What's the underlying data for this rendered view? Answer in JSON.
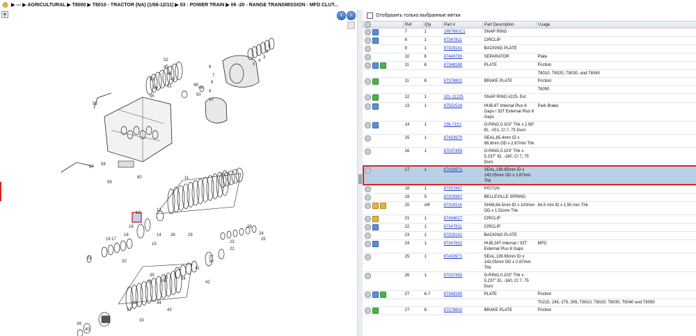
{
  "breadcrumb": [
    "---",
    "AGRICULTURAL",
    "T8000",
    "T8010 - TRACTOR (NA) (1/06-12/11)",
    "03 - POWER TRAIN",
    "06 -20 - RANGE TRANSMISSION - MFD CLUT..."
  ],
  "filter_label": "Отобразить только выбранные метки",
  "columns": {
    "ref": "Ref",
    "qty": "Qty",
    "part": "Part #",
    "desc": "Part Description",
    "usage": "Usage"
  },
  "rows": [
    {
      "icons": [
        "circle",
        "blue"
      ],
      "ref": "7",
      "qty": "1",
      "part": "1997891C1",
      "desc": "SNAP RING",
      "usage": ""
    },
    {
      "icons": [
        "circle",
        "blue"
      ],
      "ref": "8",
      "qty": "1",
      "part": "87347811",
      "desc": "CIRCLIP",
      "usage": ""
    },
    {
      "icons": [
        "circle"
      ],
      "ref": "9",
      "qty": "1",
      "part": "87329141",
      "desc": "BACKING PLATE",
      "usage": ""
    },
    {
      "icons": [
        "circle"
      ],
      "ref": "10",
      "qty": "6",
      "part": "87449793",
      "desc": "SEPARATOR",
      "usage": "Plate"
    },
    {
      "icons": [
        "circle",
        "blue",
        "green"
      ],
      "ref": "11",
      "qty": "6",
      "part": "87348160",
      "desc": "PLATE",
      "usage": "Friction"
    },
    {
      "icons": [],
      "ref": "",
      "qty": "",
      "part": "",
      "desc": "",
      "usage": "T8010, T8020, T8030, and T8040"
    },
    {
      "icons": [
        "circle",
        "green"
      ],
      "ref": "11",
      "qty": "6",
      "part": "87378802",
      "desc": "BRAKE PLATE",
      "usage": "Friction"
    },
    {
      "icons": [],
      "ref": "",
      "qty": "",
      "part": "",
      "desc": "",
      "usage": "T8050"
    },
    {
      "icons": [
        "circle",
        "green"
      ],
      "ref": "12",
      "qty": "1",
      "part": "101-11225",
      "desc": "SNAP RING,#225, Ext",
      "usage": ""
    },
    {
      "icons": [
        "circle",
        "blue"
      ],
      "ref": "13",
      "qty": "1",
      "part": "87552528",
      "desc": "HUB,6T Internal Plus 6 Gaps / 33T External Plus 6 Gaps",
      "usage": "Park Brake"
    },
    {
      "icons": [
        "circle",
        "blue"
      ],
      "ref": "14",
      "qty": "1",
      "part": "238-7151",
      "desc": "O-RING,0.103\" Thk x 2.99\" ID, -151, Cl 7, 75 Duro",
      "usage": ""
    },
    {
      "icons": [
        "circle"
      ],
      "ref": "15",
      "qty": "1",
      "part": "87433970",
      "desc": "SEAL,85.4mm ID x 88.8mm OD x 2.87mm Thk",
      "usage": ""
    },
    {
      "icons": [
        "circle"
      ],
      "ref": "16",
      "qty": "1",
      "part": "87037455",
      "desc": "O-RING,0.103\" Thk x 5.237\" ID, -160, Cl 7, 75 Duro",
      "usage": ""
    },
    {
      "icons": [
        "circle"
      ],
      "ref": "17",
      "qty": "1",
      "part": "87433971",
      "desc": "SEAL,139.65mm ID x 143.05mm OD x 2.87mm Thk",
      "usage": "",
      "selected": true
    },
    {
      "icons": [
        "circle"
      ],
      "ref": "18",
      "qty": "1",
      "part": "87337887",
      "desc": "PISTON",
      "usage": ""
    },
    {
      "icons": [
        "circle"
      ],
      "ref": "19",
      "qty": "5",
      "part": "87305967",
      "desc": "BELLEVILLE SPRING",
      "usage": ""
    },
    {
      "icons": [
        "circle",
        "box",
        "box"
      ],
      "ref": "20",
      "qty": "AR",
      "part": "87329116",
      "desc": "SHIM,84.5mm ID x 100mm OD x 1.52mm Thk",
      "usage": "84.5 mm ID x 1.50 mm Thk"
    },
    {
      "icons": [
        "circle",
        "box"
      ],
      "ref": "21",
      "qty": "1",
      "part": "87434027",
      "desc": "CIRCLIP",
      "usage": ""
    },
    {
      "icons": [
        "circle",
        "blue"
      ],
      "ref": "22",
      "qty": "1",
      "part": "87347811",
      "desc": "CIRCLIP",
      "usage": ""
    },
    {
      "icons": [
        "circle"
      ],
      "ref": "23",
      "qty": "1",
      "part": "87329141",
      "desc": "BACKING PLATE",
      "usage": ""
    },
    {
      "icons": [
        "circle",
        "blue"
      ],
      "ref": "24",
      "qty": "1",
      "part": "87347832",
      "desc": "HUB,24T Internal / 33T External Plus 6 Gaps",
      "usage": "MFD"
    },
    {
      "icons": [
        "circle"
      ],
      "ref": "25",
      "qty": "1",
      "part": "87433971",
      "desc": "SEAL,139.65mm ID x 143.05mm OD x 2.87mm Thk",
      "usage": ""
    },
    {
      "icons": [
        "circle"
      ],
      "ref": "26",
      "qty": "1",
      "part": "87037455",
      "desc": "O-RING,0.103\" Thk x 5.237\" ID, -160, Cl 7, 75 Duro",
      "usage": ""
    },
    {
      "icons": [
        "circle",
        "blue",
        "green"
      ],
      "ref": "27",
      "qty": "6-7",
      "part": "87348160",
      "desc": "PLATE",
      "usage": "Friction"
    },
    {
      "icons": [],
      "ref": "",
      "qty": "",
      "part": "",
      "desc": "",
      "usage": "T0215, 245, 275, 305, T8010, T8020, T8030, T8040 and T8050"
    },
    {
      "icons": [
        "circle",
        "green"
      ],
      "ref": "27",
      "qty": "8",
      "part": "87378802",
      "desc": "BRAKE PLATE",
      "usage": "Friction"
    }
  ],
  "callouts": [
    "1",
    "2",
    "3",
    "4",
    "5",
    "6",
    "7",
    "8",
    "9",
    "10",
    "11",
    "12",
    "13",
    "14",
    "15",
    "16",
    "17",
    "18",
    "19",
    "20",
    "21",
    "22",
    "23",
    "24",
    "25",
    "26",
    "27",
    "28",
    "29",
    "30",
    "31",
    "32",
    "33",
    "34",
    "35",
    "36",
    "37",
    "38",
    "39",
    "40",
    "41",
    "42",
    "43",
    "44",
    "45",
    "46",
    "47",
    "48",
    "49",
    "50",
    "51",
    "52",
    "53",
    "54",
    "55",
    "56",
    "57",
    "58",
    "59",
    "60"
  ]
}
